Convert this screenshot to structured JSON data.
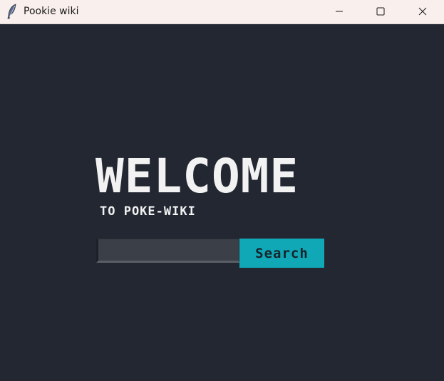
{
  "window": {
    "title": "Pookie wiki",
    "icons": {
      "app": "feather-icon",
      "minimize": "minimize-icon",
      "maximize": "maximize-icon",
      "close": "close-icon"
    }
  },
  "main": {
    "welcome_heading": "WELCOME",
    "subtitle": "TO POKE-WIKI",
    "search": {
      "value": "",
      "placeholder": "",
      "button_label": "Search"
    }
  },
  "colors": {
    "background": "#222731",
    "titlebar": "#f9efec",
    "heading_text": "#f2f2f2",
    "search_input_bg": "#3b3f48",
    "search_button_bg": "#10a8b7",
    "search_button_text": "#16242b"
  }
}
